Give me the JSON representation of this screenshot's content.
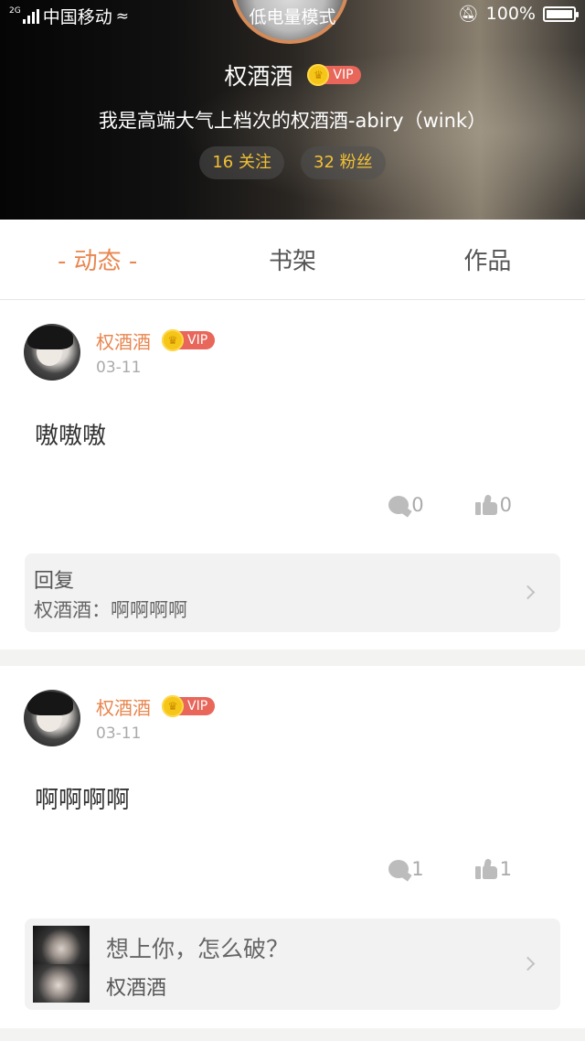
{
  "status_bar": {
    "network_tag": "2G",
    "carrier": "中国移动",
    "mode_text": "低电量模式",
    "battery_text": "100%",
    "battery_level": 1.0
  },
  "profile": {
    "name": "权酒酒",
    "vip_label": "VIP",
    "bio": "我是高端大气上档次的权酒酒-abiry（wink）",
    "following": "16 关注",
    "followers": "32 粉丝"
  },
  "tabs": [
    {
      "label": "- 动态 -",
      "active": true
    },
    {
      "label": "书架",
      "active": false
    },
    {
      "label": "作品",
      "active": false
    }
  ],
  "posts": [
    {
      "author": "权酒酒",
      "vip_label": "VIP",
      "date": "03-11",
      "content": "嗷嗷嗷",
      "comments": "0",
      "likes": "0",
      "reply_title": "回复",
      "reply_text": "权酒酒：啊啊啊啊"
    },
    {
      "author": "权酒酒",
      "vip_label": "VIP",
      "date": "03-11",
      "content": "啊啊啊啊",
      "comments": "1",
      "likes": "1",
      "share_title": "想上你，怎么破？",
      "share_author": "权酒酒"
    }
  ],
  "colors": {
    "accent": "#e8864f",
    "vip_red": "#e8665a",
    "crown_gold": "#f5c518",
    "stat_gold": "#f2c035"
  }
}
